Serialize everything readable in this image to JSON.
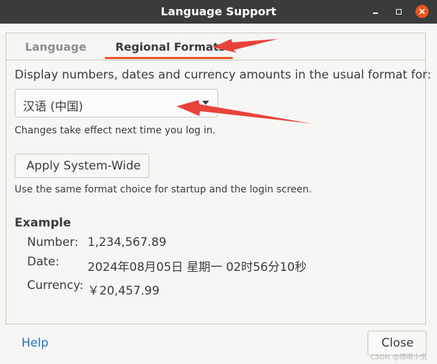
{
  "window": {
    "title": "Language Support"
  },
  "tabs": [
    {
      "label": "Language",
      "active": false
    },
    {
      "label": "Regional Formats",
      "active": true
    }
  ],
  "regional": {
    "description": "Display numbers, dates and currency amounts in the usual format for:",
    "selected_format": "汉语 (中国)",
    "change_hint": "Changes take effect next time you log in.",
    "apply_button": "Apply System-Wide",
    "apply_hint": "Use the same format choice for startup and the login screen."
  },
  "example": {
    "heading": "Example",
    "number_label": "Number:",
    "number_value": "1,234,567.89",
    "date_label": "Date:",
    "date_value": "2024年08月05日 星期一 02时56分10秒",
    "currency_label": "Currency:",
    "currency_value": "￥20,457.99"
  },
  "footer": {
    "help": "Help",
    "close": "Close"
  },
  "watermark": "CSDN @想眼小虫",
  "colors": {
    "accent": "#e95420",
    "titlebar": "#3b3b3b",
    "annotation_arrow": "#e8433a",
    "link": "#1c70c2"
  },
  "icons": {
    "minimize": "minimize-icon",
    "maximize": "maximize-icon",
    "close": "close-icon",
    "dropdown": "chevron-down-icon"
  }
}
